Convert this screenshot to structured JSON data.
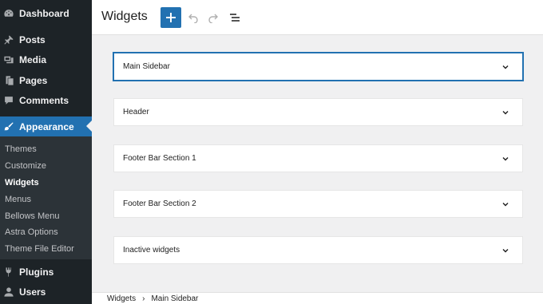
{
  "sidebar": {
    "top_items": [
      {
        "label": "Dashboard",
        "icon": "dashboard-icon"
      }
    ],
    "items_before": [
      {
        "label": "Posts",
        "icon": "pushpin-icon"
      },
      {
        "label": "Media",
        "icon": "media-icon"
      },
      {
        "label": "Pages",
        "icon": "pages-icon"
      },
      {
        "label": "Comments",
        "icon": "comment-icon"
      }
    ],
    "appearance": {
      "label": "Appearance",
      "icon": "paintbrush-icon"
    },
    "submenu": [
      "Themes",
      "Customize",
      "Widgets",
      "Menus",
      "Bellows Menu",
      "Astra Options",
      "Theme File Editor"
    ],
    "current_submenu": "Widgets",
    "items_after": [
      {
        "label": "Plugins",
        "icon": "plugin-icon"
      },
      {
        "label": "Users",
        "icon": "user-icon"
      }
    ]
  },
  "header": {
    "title": "Widgets",
    "add_button": "plus-icon",
    "undo_button": "undo-icon",
    "redo_button": "redo-icon",
    "list_view_button": "list-view-icon"
  },
  "areas": [
    {
      "title": "Main Sidebar",
      "selected": true
    },
    {
      "title": "Header",
      "selected": false
    },
    {
      "title": "Footer Bar Section 1",
      "selected": false
    },
    {
      "title": "Footer Bar Section 2",
      "selected": false
    },
    {
      "title": "Inactive widgets",
      "selected": false
    }
  ],
  "breadcrumb": {
    "root": "Widgets",
    "separator": "›",
    "current": "Main Sidebar"
  },
  "colors": {
    "sidebar_bg": "#1d2327",
    "accent": "#2271b1",
    "canvas_bg": "#f0f0f1"
  }
}
